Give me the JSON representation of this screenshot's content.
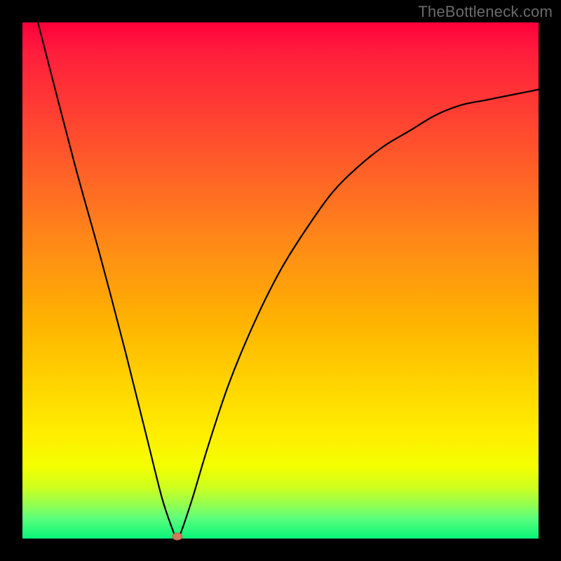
{
  "watermark": "TheBottleneck.com",
  "chart_data": {
    "type": "line",
    "title": "",
    "xlabel": "",
    "ylabel": "",
    "xlim": [
      0,
      100
    ],
    "ylim": [
      0,
      100
    ],
    "grid": false,
    "legend": false,
    "series": [
      {
        "name": "curve",
        "x": [
          3,
          10,
          15,
          20,
          24,
          27,
          29,
          30,
          31,
          33,
          36,
          40,
          45,
          50,
          55,
          60,
          65,
          70,
          75,
          80,
          85,
          90,
          95,
          100
        ],
        "y": [
          100,
          73,
          55,
          36,
          20,
          8,
          2,
          0,
          2,
          8,
          18,
          30,
          42,
          52,
          60,
          67,
          72,
          76,
          79,
          82,
          84,
          85,
          86,
          87
        ]
      }
    ],
    "marker": {
      "x": 30,
      "y": 0,
      "color": "#d17a5c"
    },
    "background_gradient": [
      "#ff003b",
      "#ff6a24",
      "#ffd400",
      "#f3ff00",
      "#08f57a"
    ]
  }
}
